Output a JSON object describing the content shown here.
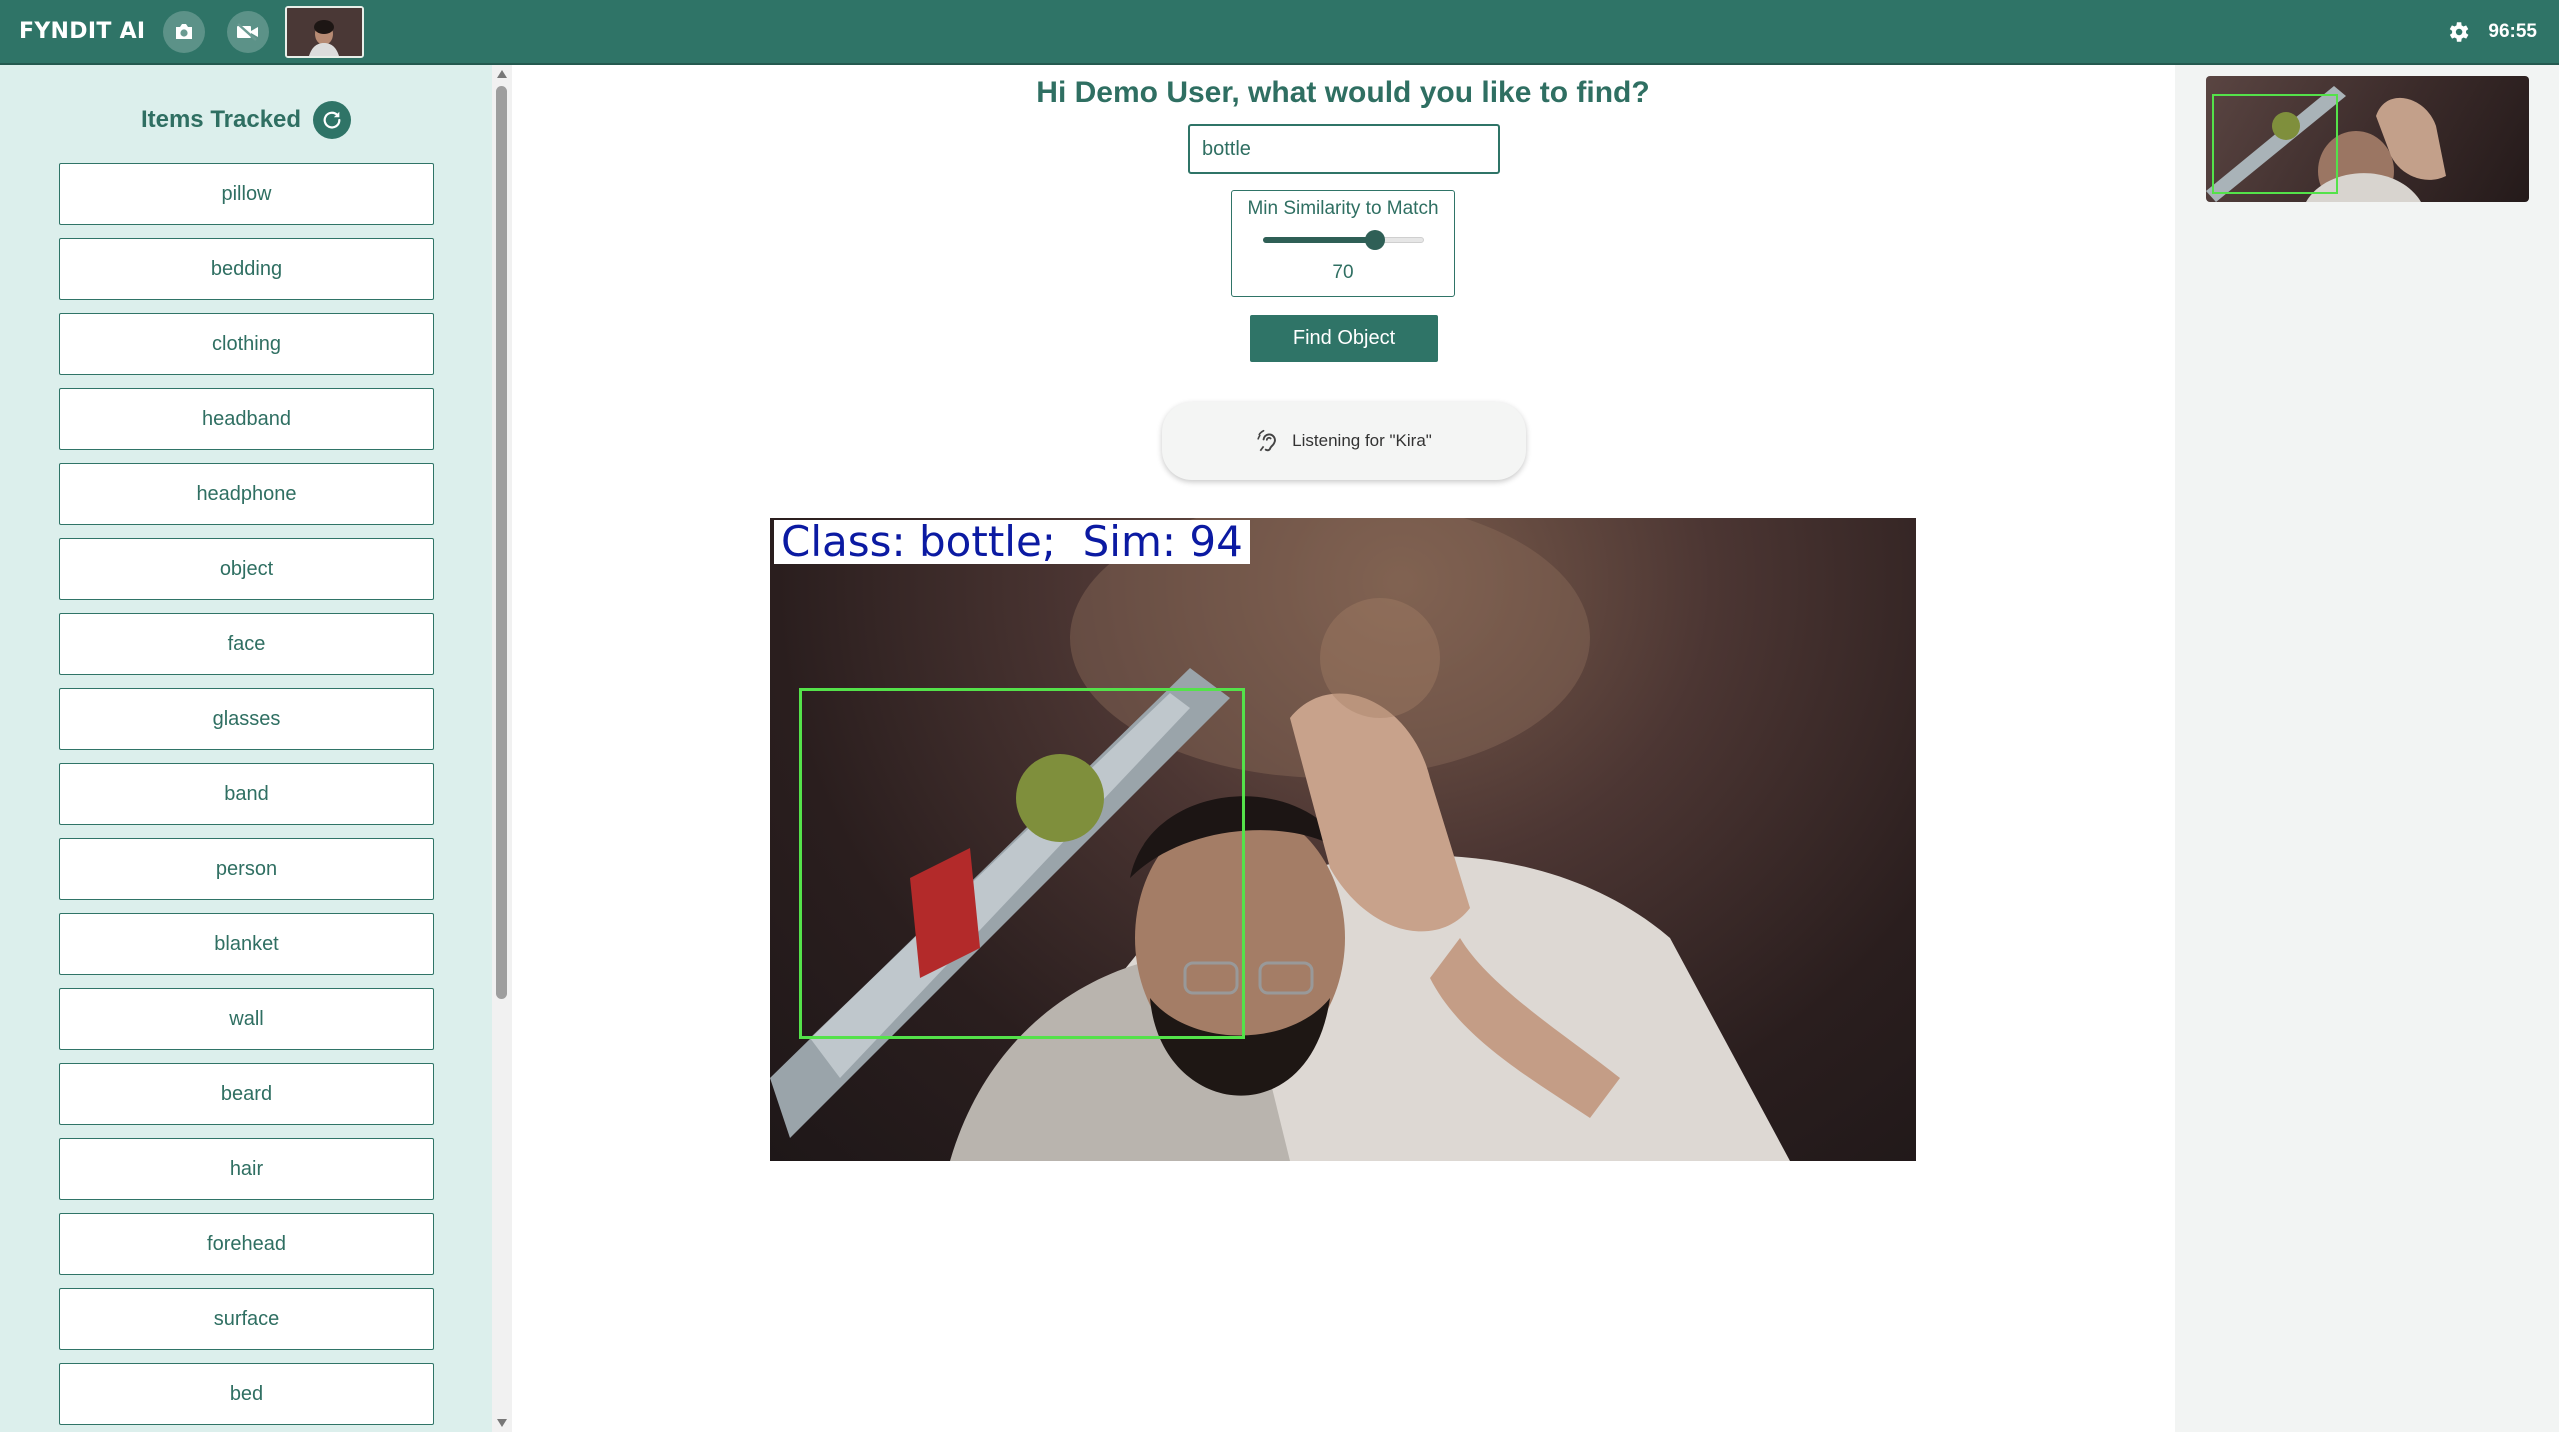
{
  "topbar": {
    "brand": "FYNDIT AI",
    "camera_icon": "camera-icon",
    "video_off_icon": "video-off-icon",
    "settings_icon": "gear-icon",
    "timer": "96:55"
  },
  "sidebar": {
    "title": "Items Tracked",
    "refresh_icon": "refresh-icon",
    "items": [
      {
        "label": "pillow"
      },
      {
        "label": "bedding"
      },
      {
        "label": "clothing"
      },
      {
        "label": "headband"
      },
      {
        "label": "headphone"
      },
      {
        "label": "object"
      },
      {
        "label": "face"
      },
      {
        "label": "glasses"
      },
      {
        "label": "band"
      },
      {
        "label": "person"
      },
      {
        "label": "blanket"
      },
      {
        "label": "wall"
      },
      {
        "label": "beard"
      },
      {
        "label": "hair"
      },
      {
        "label": "forehead"
      },
      {
        "label": "surface"
      },
      {
        "label": "bed"
      }
    ]
  },
  "main": {
    "greeting": "Hi Demo User, what would you like to find?",
    "search_value": "bottle",
    "similarity": {
      "label": "Min Similarity to Match",
      "value": "70",
      "fraction": 0.7
    },
    "find_button": "Find Object",
    "listening": "Listening for \"Kira\"",
    "detection_label": "Class: bottle;  Sim: 94"
  },
  "colors": {
    "primary": "#2f7467",
    "sidebar_bg": "#dcefec",
    "detection_box": "#54e24a",
    "detection_text": "#0b1aa2"
  }
}
